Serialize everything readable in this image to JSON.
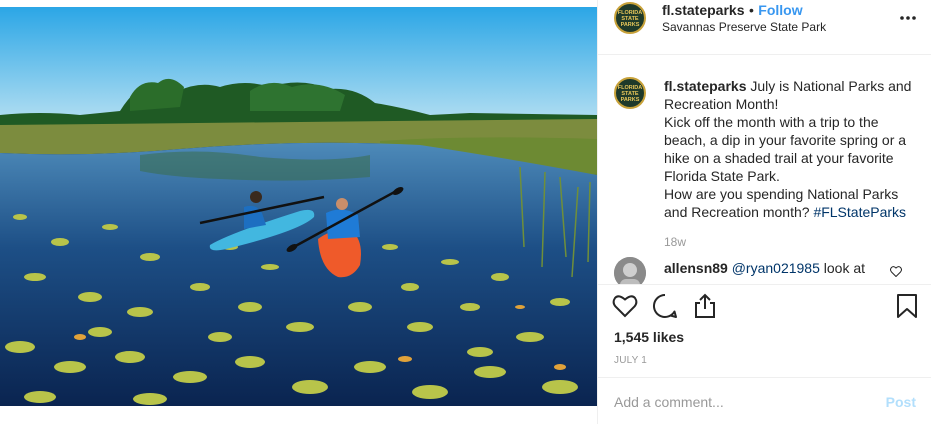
{
  "post": {
    "author": {
      "username": "fl.stateparks",
      "avatar_text": "FLORIDA STATE PARKS"
    },
    "follow_label": "Follow",
    "separator": "•",
    "location": "Savannas Preserve State Park",
    "caption": {
      "username": "fl.stateparks",
      "text_1": " July is National Parks and Recreation Month!",
      "text_2": "Kick off the month with a trip to the beach, a dip in your favorite spring or a hike on a shaded trail at your favorite Florida State Park.",
      "text_3": "How are you spending National Parks and Recreation month? ",
      "hashtag": "#FLStateParks"
    },
    "time_ago": "18w",
    "comments": [
      {
        "username": "allensn89",
        "mention": "@ryan021985",
        "text": " look at"
      }
    ],
    "likes": "1,545 likes",
    "date": "JULY 1",
    "add_comment": {
      "placeholder": "Add a comment...",
      "post_label": "Post"
    }
  },
  "icons": {
    "more": "more-horizontal-icon",
    "like": "heart-icon",
    "comment": "comment-bubble-icon",
    "share": "share-icon",
    "save": "bookmark-icon"
  },
  "colors": {
    "follow": "#3897f0",
    "muted": "#999999",
    "post_disabled": "#b2dffc",
    "text": "#262626"
  }
}
